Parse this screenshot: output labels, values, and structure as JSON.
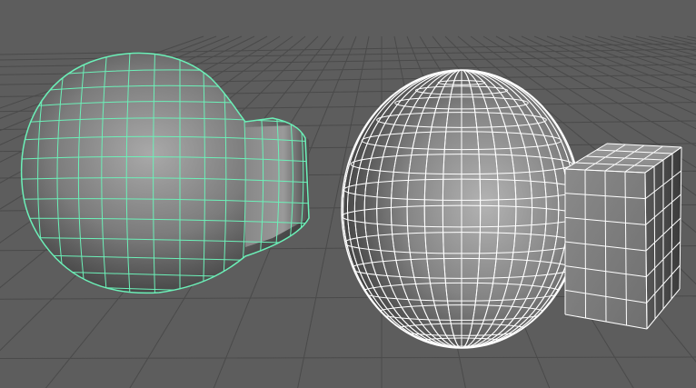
{
  "viewport": {
    "background_color": "#5d5d5d",
    "grid_color": "#4a4a4a",
    "grid_visible": true
  },
  "objects": [
    {
      "name": "merged-bulb-mesh",
      "description_shape": "sphere combined with cube, smoothed",
      "state": "selected",
      "wire_color": "#6cf0b8"
    },
    {
      "name": "sphere-and-cube",
      "description_shape": "sphere intersecting a cube",
      "state": "unselected",
      "wire_color": "#ffffff"
    }
  ]
}
